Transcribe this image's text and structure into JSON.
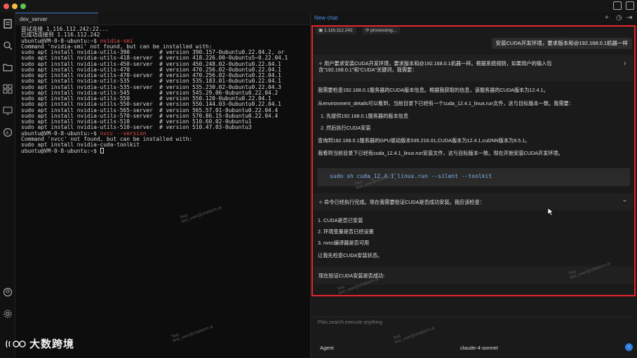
{
  "terminal": {
    "tab_label": "dev_server",
    "lines": [
      {
        "t": "尝试连接 1.116.112.242:22..."
      },
      {
        "t": "已成功连接到 1.116.112.242"
      },
      {
        "t": "ubuntu@VM-0-8-ubuntu:~$ ",
        "cmd": "nvidia-smi"
      },
      {
        "t": "Command 'nvidia-smi' not found, but can be installed with:"
      },
      {
        "t": "sudo apt install nvidia-utils-390         # version 390.157-0ubuntu0.22.04.2, or"
      },
      {
        "t": "sudo apt install nvidia-utils-418-server  # version 418.226.00-0ubuntu5~0.22.04.1"
      },
      {
        "t": "sudo apt install nvidia-utils-450-server  # version 450.248.02-0ubuntu0.22.04.1"
      },
      {
        "t": "sudo apt install nvidia-utils-470         # version 470.256.02-0ubuntu0.22.04.1"
      },
      {
        "t": "sudo apt install nvidia-utils-470-server  # version 470.256.02-0ubuntu0.22.04.1"
      },
      {
        "t": "sudo apt install nvidia-utils-535         # version 535.183.01-0ubuntu0.22.04.1"
      },
      {
        "t": "sudo apt install nvidia-utils-535-server  # version 535.230.02-0ubuntu0.22.04.3"
      },
      {
        "t": "sudo apt install nvidia-utils-545         # version 545.29.06-0ubuntu0.22.04.2"
      },
      {
        "t": "sudo apt install nvidia-utils-550         # version 550.120-0ubuntu0.22.04.1"
      },
      {
        "t": "sudo apt install nvidia-utils-550-server  # version 550.144.03-0ubuntu0.22.04.1"
      },
      {
        "t": "sudo apt install nvidia-utils-565-server  # version 565.57.01-0ubuntu0.22.04.4"
      },
      {
        "t": "sudo apt install nvidia-utils-570-server  # version 570.86.15-0ubuntu0.22.04.4"
      },
      {
        "t": "sudo apt install nvidia-utils-510         # version 510.60.02-0ubuntu1"
      },
      {
        "t": "sudo apt install nvidia-utils-510-server  # version 510.47.03-0ubuntu3"
      },
      {
        "t": "ubuntu@VM-0-8-ubuntu:~$ ",
        "cmd": "nvcc --version"
      },
      {
        "t": "Command 'nvcc' not found, but can be installed with:"
      },
      {
        "t": "sudo apt install nvidia-cuda-toolkit"
      },
      {
        "t": "ubuntu@VM-0-8-ubuntu:~$ ",
        "cursor": true
      }
    ]
  },
  "chat": {
    "title": "New chat",
    "host_pill": "1.116.112.242",
    "status_pill": "processing...",
    "user_message": "安装CUDA开发环境，要求版本和@192.168.0.1机器一样",
    "thought1_line1": "用户要求安装CUDA开发环境，要求版本和@192.168.0.1机器一样。根据系统规则，如果用户的输入包",
    "thought1_line2": "含\"192.168.0.1\"和\"CUDA\"关键词，我需要：",
    "p1": "我需要检查192.168.0.1服务器的CUDA版本信息。根据我获取的信息，该服务器的CUDA版本为12.4.1。",
    "p2": "从environment_details可以看到，当前目录下已经有一个cuda_12.4.1_linux.run文件，这与目标版本一致。我需要：",
    "list1": [
      "1. 先提供192.168.0.1服务器的版本信息",
      "2. 然后执行CUDA安装"
    ],
    "p3": "查询到192.168.0.1服务器的GPU驱动版本535.216.01,CUDA版本为12.4.1,cuDNN版本为9.5.1。",
    "p4": "我看到当前目录下已经有cuda_12.4.1_linux.run安装文件，这与目标版本一致。现在开始安装CUDA开发环境。",
    "code": "sudo sh cuda_12.4.1_linux.run --silent --toolkit",
    "thought2": "命令已经执行完成。现在我需要验证CUDA是否成功安装。我应该检查：",
    "list2": [
      "1. CUDA是否已安装",
      "2. 环境变量是否已经设置",
      "3. nvcc编译器是否可用"
    ],
    "p5": "让我先检查CUDA安装状态。",
    "p6": "现在验证CUDA安装是否成功:",
    "input_placeholder": "Plan,search,execute anything",
    "agent_label": "Agent",
    "model_label": "claude-4-sonnet"
  },
  "watermarks": [
    "Test",
    "test_user@chatterm.ai"
  ],
  "brand": "大数跨境",
  "colors": {
    "accent": "#4a8fdf",
    "highlight_border": "#e8242b",
    "error_text": "#e0504a"
  }
}
